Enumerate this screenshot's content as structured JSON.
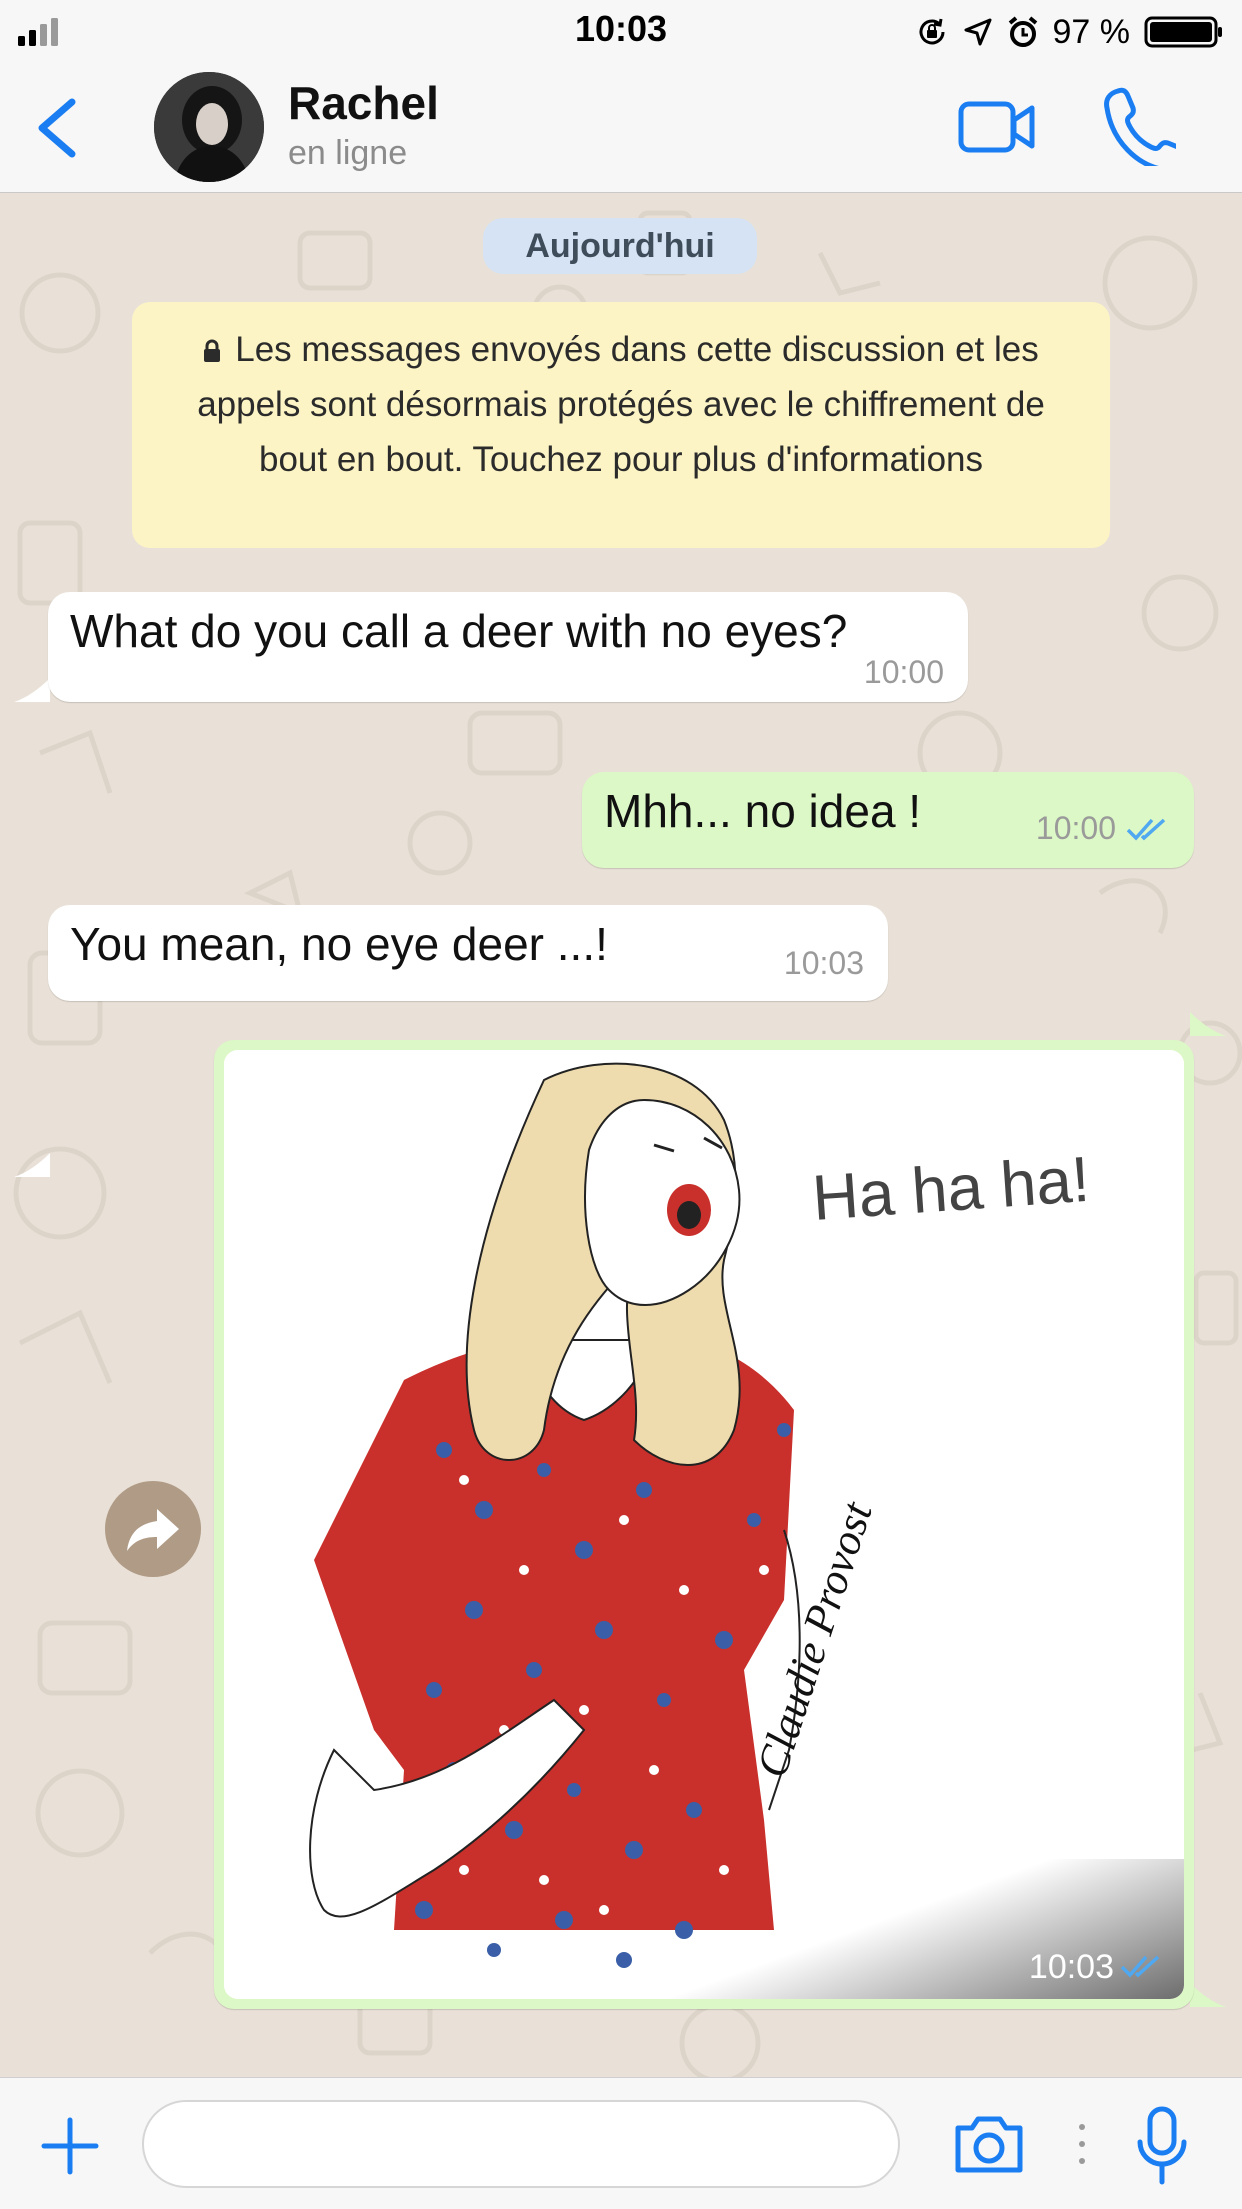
{
  "status_bar": {
    "time": "10:03",
    "battery_percent": "97 %",
    "icons": [
      "signal-icon",
      "orientation-lock-icon",
      "location-icon",
      "alarm-icon",
      "battery-icon"
    ]
  },
  "header": {
    "contact_name": "Rachel",
    "contact_status": "en ligne",
    "icons": [
      "back-chevron-icon",
      "video-call-icon",
      "phone-call-icon"
    ]
  },
  "colors": {
    "accent": "#1a7ef2",
    "outgoing_bubble": "#dcf8c6",
    "incoming_bubble": "#ffffff",
    "read_ticks": "#4fa8f0",
    "chat_background": "#e9e1d7",
    "encryption_notice": "#fcf4c5",
    "date_pill": "#d5e3f4"
  },
  "chat": {
    "date_separator": "Aujourd'hui",
    "encryption_notice": "Les messages envoyés dans cette discussion et les appels sont désormais protégés avec le chiffrement de bout en bout. Touchez pour plus d'informations",
    "messages": [
      {
        "direction": "incoming",
        "text": "What do you call a deer with no eyes?",
        "time": "10:00"
      },
      {
        "direction": "outgoing",
        "text": "Mhh... no idea !",
        "time": "10:00",
        "status": "read"
      },
      {
        "direction": "incoming",
        "text": "You mean, no eye deer ...!",
        "time": "10:03"
      },
      {
        "direction": "outgoing",
        "type": "image",
        "time": "10:03",
        "status": "read",
        "image_text": "Ha ha ha!",
        "image_signature": "Claudie Provost"
      }
    ]
  },
  "input_bar": {
    "placeholder": "",
    "icons": [
      "plus-icon",
      "camera-icon",
      "microphone-icon"
    ]
  }
}
